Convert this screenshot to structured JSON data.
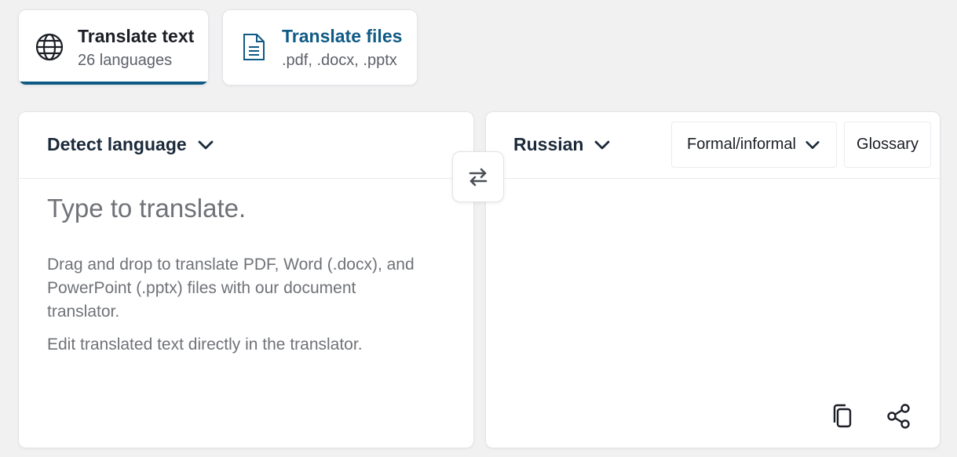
{
  "tabs": {
    "translate_text": {
      "title": "Translate text",
      "subtitle": "26 languages",
      "icon": "globe-icon"
    },
    "translate_files": {
      "title": "Translate files",
      "subtitle": ".pdf, .docx, .pptx",
      "icon": "document-icon"
    }
  },
  "source": {
    "language_label": "Detect language",
    "placeholder": "Type to translate.",
    "hint_drag": "Drag and drop to translate PDF, Word (.docx), and PowerPoint (.pptx) files with our document translator.",
    "hint_edit": "Edit translated text directly in the translator."
  },
  "target": {
    "language_label": "Russian",
    "formality_label": "Formal/informal",
    "glossary_label": "Glossary",
    "actions": [
      "copy-icon",
      "share-icon"
    ]
  },
  "swap": {
    "icon": "swap-arrows-icon"
  },
  "colors": {
    "accent": "#0f5a85",
    "background": "#f1f1f2",
    "panel": "#ffffff",
    "text_dark": "#1b2a3a",
    "text_muted": "#6f7277"
  }
}
